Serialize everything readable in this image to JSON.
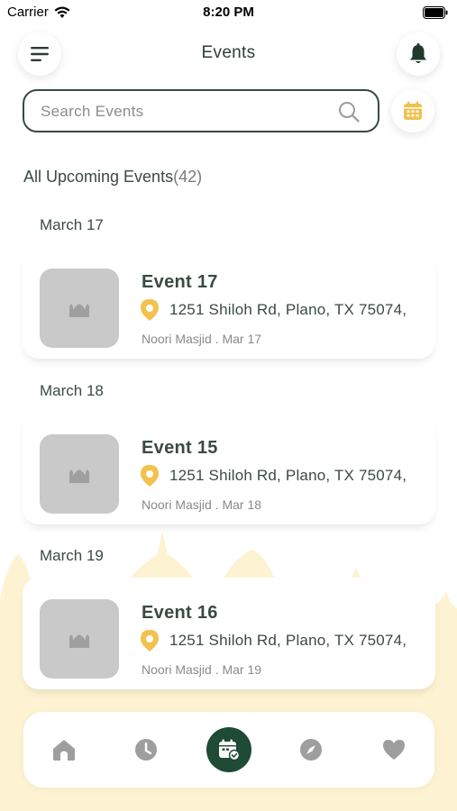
{
  "status_bar": {
    "carrier": "Carrier",
    "time": "8:20 PM"
  },
  "header": {
    "title": "Events",
    "menu_icon": "hamburger-menu-icon",
    "bell_icon": "bell-icon"
  },
  "search": {
    "placeholder": "Search Events",
    "value": "",
    "icon": "search-icon",
    "calendar_icon": "calendar-icon"
  },
  "section": {
    "heading": "All Upcoming Events",
    "count": "(42)"
  },
  "events": [
    {
      "date": "March 17",
      "title": "Event 17",
      "address": "1251 Shiloh Rd, Plano, TX 75074,",
      "meta": "Noori Masjid . Mar 17"
    },
    {
      "date": "March 18",
      "title": "Event 15",
      "address": "1251 Shiloh Rd, Plano, TX 75074,",
      "meta": "Noori Masjid . Mar 18"
    },
    {
      "date": "March 19",
      "title": "Event 16",
      "address": "1251 Shiloh Rd, Plano, TX 75074,",
      "meta": "Noori Masjid . Mar 19"
    }
  ],
  "nav": [
    {
      "icon": "home-icon",
      "active": false
    },
    {
      "icon": "clock-icon",
      "active": false
    },
    {
      "icon": "calendar-check-icon",
      "active": true
    },
    {
      "icon": "compass-icon",
      "active": false
    },
    {
      "icon": "heart-icon",
      "active": false
    }
  ],
  "colors": {
    "accent_green": "#1f4a35",
    "pin_yellow": "#f2c14e",
    "background_art": "#fdf3cf",
    "thumb_gray": "#c9c9c9"
  }
}
